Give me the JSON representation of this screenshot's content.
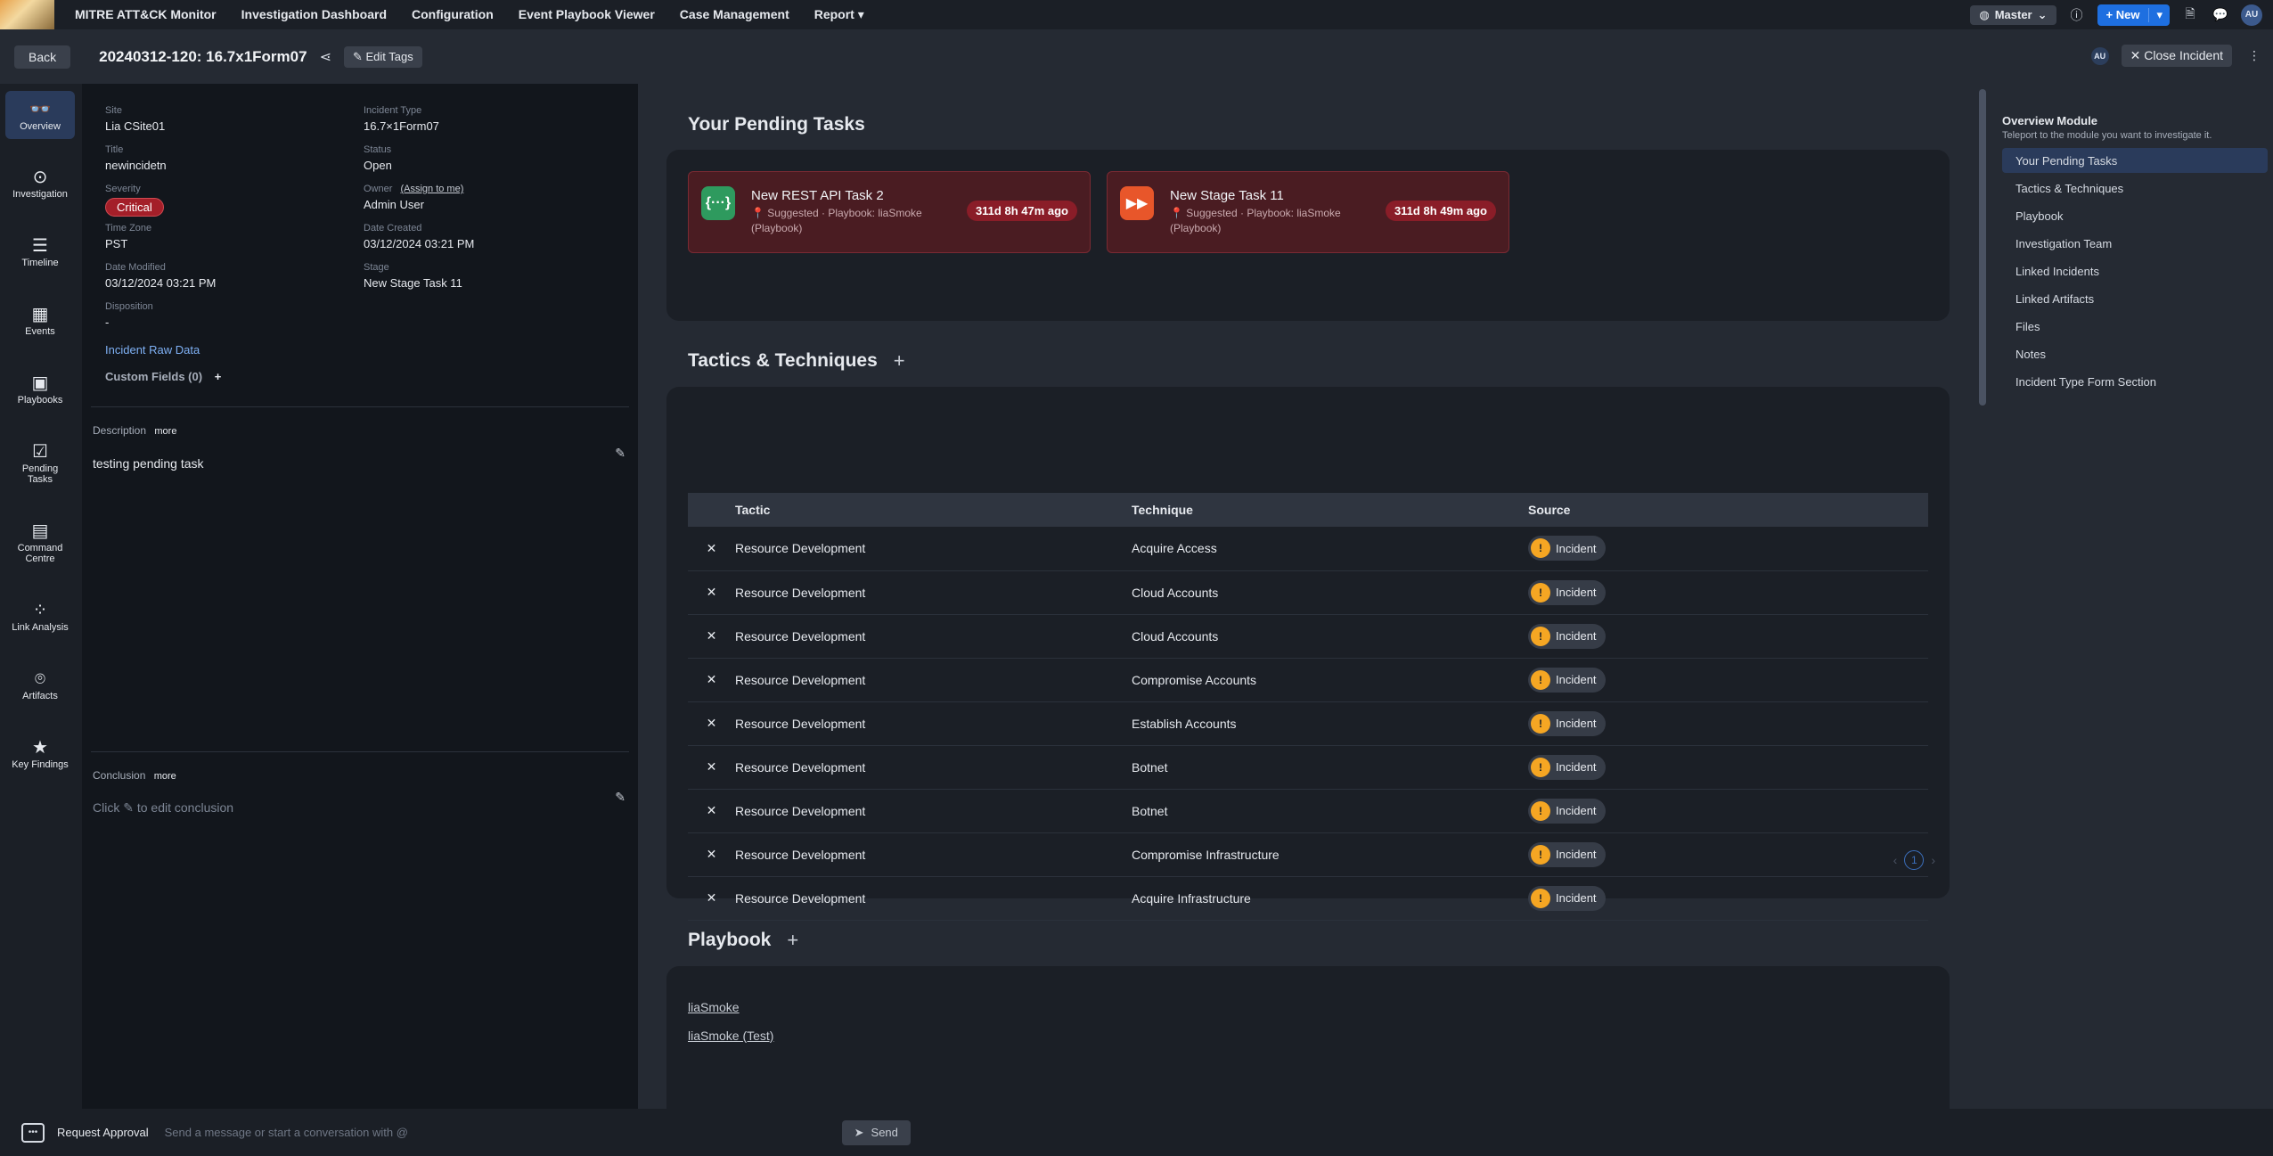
{
  "topnav": {
    "links": [
      "MITRE ATT&CK Monitor",
      "Investigation Dashboard",
      "Configuration",
      "Event Playbook Viewer",
      "Case Management",
      "Report ▾"
    ],
    "workspace": "Master",
    "new_label": "+ New",
    "avatar": "AU"
  },
  "header": {
    "back_label": "Back",
    "title": "20240312-120: 16.7x1Form07",
    "edit_tags_label": "Edit Tags",
    "avatar": "AU",
    "close_label": "Close Incident"
  },
  "rail": [
    {
      "label": "Overview",
      "icon": "binoculars-icon"
    },
    {
      "label": "Investigation",
      "icon": "target-icon"
    },
    {
      "label": "Timeline",
      "icon": "timeline-icon"
    },
    {
      "label": "Events",
      "icon": "calendar-icon"
    },
    {
      "label": "Playbooks",
      "icon": "playbook-icon"
    },
    {
      "label": "Pending Tasks",
      "icon": "checklist-icon"
    },
    {
      "label": "Command Centre",
      "icon": "window-icon"
    },
    {
      "label": "Link Analysis",
      "icon": "graph-icon"
    },
    {
      "label": "Artifacts",
      "icon": "fingerprint-icon"
    },
    {
      "label": "Key Findings",
      "icon": "star-icon"
    }
  ],
  "details": {
    "site_label": "Site",
    "site": "Lia CSite01",
    "incident_type_label": "Incident Type",
    "incident_type": "16.7×1Form07",
    "title_label": "Title",
    "title": "newincidetn",
    "status_label": "Status",
    "status": "Open",
    "severity_label": "Severity",
    "severity": "Critical",
    "owner_label": "Owner",
    "assign_label": "(Assign to me)",
    "owner": "Admin User",
    "timezone_label": "Time Zone",
    "timezone": "PST",
    "date_created_label": "Date Created",
    "date_created": "03/12/2024 03:21 PM",
    "date_modified_label": "Date Modified",
    "date_modified": "03/12/2024 03:21 PM",
    "stage_label": "Stage",
    "stage": "New Stage Task 11",
    "disposition_label": "Disposition",
    "disposition": "-",
    "raw_data_link": "Incident Raw Data",
    "custom_fields": "Custom Fields (0)",
    "description_label": "Description",
    "more": "more",
    "description": "testing pending task",
    "conclusion_label": "Conclusion",
    "conclusion_hint_a": "Click",
    "conclusion_hint_b": "to edit conclusion"
  },
  "pending": {
    "title": "Your Pending Tasks",
    "tasks": [
      {
        "title": "New REST API Task 2",
        "sub": "📍 Suggested · Playbook: liaSmoke (Playbook)",
        "time": "311d 8h 47m ago",
        "icon_color": "#2e9a5e",
        "icon": "{···}"
      },
      {
        "title": "New Stage Task 11",
        "sub": "📍 Suggested · Playbook: liaSmoke (Playbook)",
        "time": "311d 8h 49m ago",
        "icon_color": "#e8562a",
        "icon": "▶▶"
      }
    ]
  },
  "tactics": {
    "title": "Tactics & Techniques",
    "headers": [
      "Tactic",
      "Technique",
      "Source"
    ],
    "rows": [
      {
        "tactic": "Resource Development",
        "technique": "Acquire Access",
        "source": "Incident"
      },
      {
        "tactic": "Resource Development",
        "technique": "Cloud Accounts",
        "source": "Incident"
      },
      {
        "tactic": "Resource Development",
        "technique": "Cloud Accounts",
        "source": "Incident"
      },
      {
        "tactic": "Resource Development",
        "technique": "Compromise Accounts",
        "source": "Incident"
      },
      {
        "tactic": "Resource Development",
        "technique": "Establish Accounts",
        "source": "Incident"
      },
      {
        "tactic": "Resource Development",
        "technique": "Botnet",
        "source": "Incident"
      },
      {
        "tactic": "Resource Development",
        "technique": "Botnet",
        "source": "Incident"
      },
      {
        "tactic": "Resource Development",
        "technique": "Compromise Infrastructure",
        "source": "Incident"
      },
      {
        "tactic": "Resource Development",
        "technique": "Acquire Infrastructure",
        "source": "Incident"
      }
    ],
    "page": "1"
  },
  "playbook": {
    "title": "Playbook",
    "links": [
      "liaSmoke",
      "liaSmoke (Test)"
    ]
  },
  "overview_module": {
    "title": "Overview Module",
    "subtitle": "Teleport to the module you want to investigate it.",
    "items": [
      "Your Pending Tasks",
      "Tactics & Techniques",
      "Playbook",
      "Investigation Team",
      "Linked Incidents",
      "Linked Artifacts",
      "Files",
      "Notes",
      "Incident Type Form Section"
    ]
  },
  "chat": {
    "request_label": "Request Approval",
    "placeholder": "Send a message or start a conversation with @",
    "send_label": "Send"
  }
}
